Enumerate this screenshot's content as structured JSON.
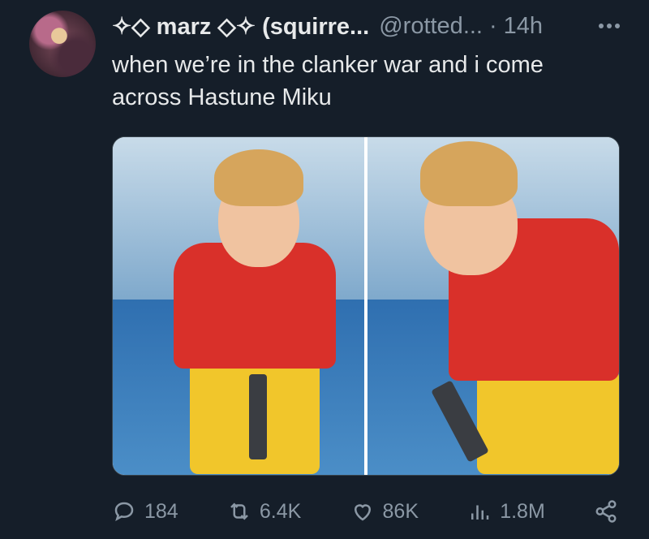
{
  "tweet": {
    "display_name": "✧◇ marz ◇✧ (squirre...",
    "handle": "@rotted...",
    "separator": "·",
    "time": "14h",
    "text": "when we’re in the clanker war and i come across Hastune Miku"
  },
  "actions": {
    "replies": "184",
    "reposts": "6.4K",
    "likes": "86K",
    "views": "1.8M"
  },
  "icons": [
    "more-icon",
    "reply-icon",
    "repost-icon",
    "like-icon",
    "views-icon",
    "share-icon"
  ],
  "colors": {
    "background": "#151e29",
    "text": "#e7e9ea",
    "muted": "#8b98a5"
  }
}
